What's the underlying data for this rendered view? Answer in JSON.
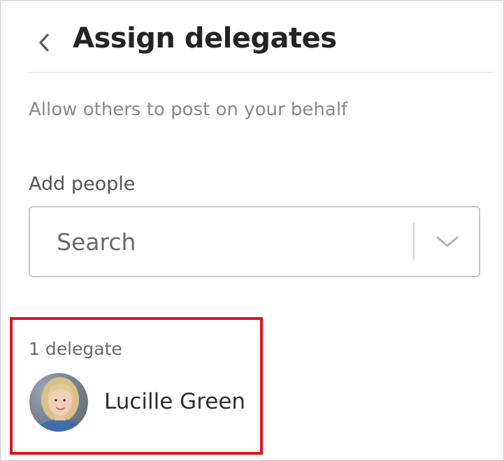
{
  "header": {
    "back_icon": "chevron-left-icon",
    "title": "Assign delegates"
  },
  "subtitle": "Allow others to post on your behalf",
  "add_people": {
    "label": "Add people",
    "search_placeholder": "Search",
    "dropdown_icon": "chevron-down-icon"
  },
  "delegates": {
    "count_text": "1 delegate",
    "items": [
      {
        "name": "Lucille Green",
        "avatar": "profile-photo"
      }
    ]
  },
  "colors": {
    "highlight_border": "#e2121f",
    "title_text": "#242424",
    "muted_text": "#8a8a8a"
  }
}
